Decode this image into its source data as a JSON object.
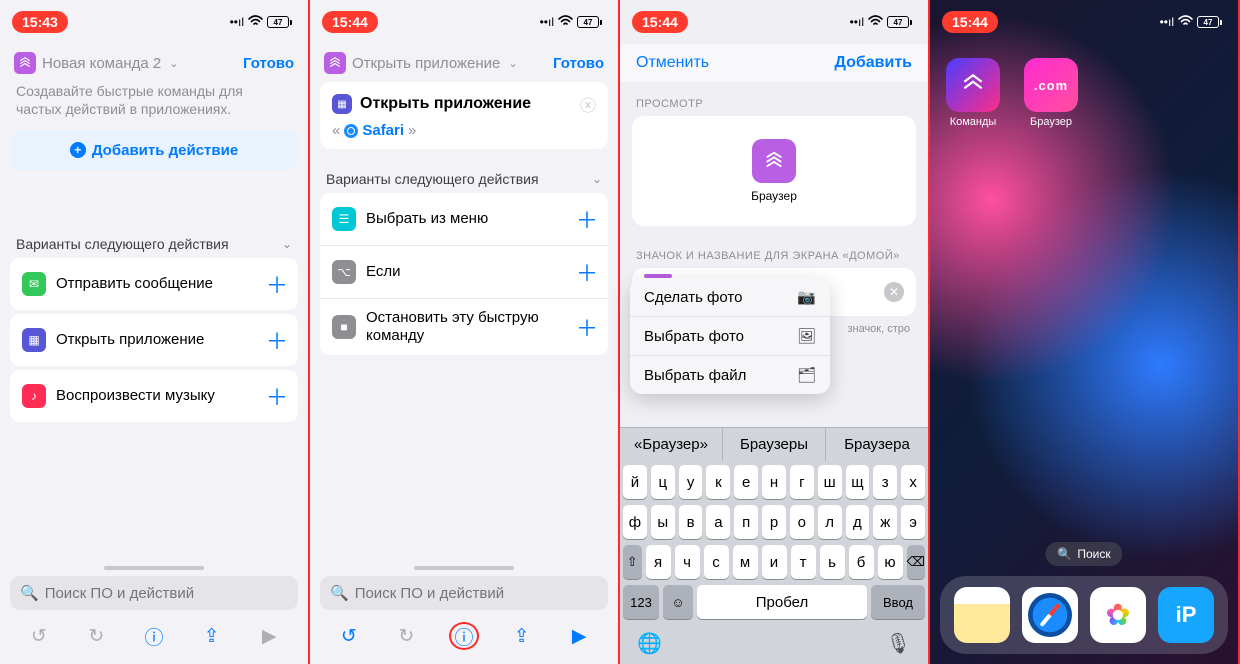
{
  "status": {
    "battery": "47"
  },
  "panel1": {
    "time": "15:43",
    "title": "Новая команда 2",
    "done": "Готово",
    "hint": "Создавайте быстрые команды для частых действий в приложениях.",
    "addAction": "Добавить действие",
    "sectionHeader": "Варианты следующего действия",
    "rows": [
      {
        "label": "Отправить сообщение",
        "iconColor": "#34c759"
      },
      {
        "label": "Открыть приложение",
        "iconColor": "#5856d6",
        "highlighted": true
      },
      {
        "label": "Воспроизвести музыку",
        "iconColor": "#ff2d55"
      }
    ],
    "searchPlaceholder": "Поиск ПО и действий"
  },
  "panel2": {
    "time": "15:44",
    "title": "Открыть приложение",
    "done": "Готово",
    "card": {
      "title": "Открыть приложение",
      "param": "Safari"
    },
    "sectionHeader": "Варианты следующего действия",
    "rows": [
      {
        "label": "Выбрать из меню",
        "iconColor": "#00c7d4"
      },
      {
        "label": "Если",
        "iconColor": "#8e8e93"
      },
      {
        "label": "Остановить эту быструю команду",
        "iconColor": "#8e8e93"
      }
    ],
    "searchPlaceholder": "Поиск ПО и действий"
  },
  "panel3": {
    "time": "15:44",
    "cancel": "Отменить",
    "add": "Добавить",
    "previewHeader": "ПРОСМОТР",
    "previewLabel": "Браузер",
    "homeHeader": "ЗНАЧОК И НАЗВАНИЕ ДЛЯ ЭКРАНА «ДОМОЙ»",
    "hintUnder": "значок,\nстро",
    "popover": [
      "Сделать фото",
      "Выбрать фото",
      "Выбрать файл"
    ],
    "suggestions": [
      "«Браузер»",
      "Браузеры",
      "Браузера"
    ],
    "keyboard": {
      "r1": [
        "й",
        "ц",
        "у",
        "к",
        "е",
        "н",
        "г",
        "ш",
        "щ",
        "з",
        "х"
      ],
      "r2": [
        "ф",
        "ы",
        "в",
        "а",
        "п",
        "р",
        "о",
        "л",
        "д",
        "ж",
        "э"
      ],
      "r3": [
        "я",
        "ч",
        "с",
        "м",
        "и",
        "т",
        "ь",
        "б",
        "ю"
      ],
      "numKey": "123",
      "space": "Пробел",
      "enter": "Ввод"
    }
  },
  "panel4": {
    "time": "15:44",
    "apps": [
      {
        "label": "Команды"
      },
      {
        "label": "Браузер",
        "iconText": ".com"
      }
    ],
    "search": "Поиск"
  }
}
